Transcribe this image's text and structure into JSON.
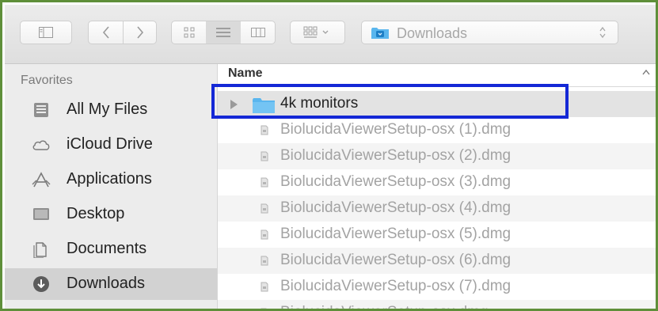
{
  "toolbar": {
    "path_title": "Downloads",
    "icons": [
      "sidebar-toggle-icon",
      "back-icon",
      "forward-icon",
      "icon-view-icon",
      "list-view-icon",
      "column-view-icon",
      "arrange-icon",
      "downloads-folder-icon",
      "stepper-icon"
    ]
  },
  "sidebar": {
    "header": "Favorites",
    "items": [
      {
        "label": "All My Files",
        "icon": "all-files-icon"
      },
      {
        "label": "iCloud Drive",
        "icon": "cloud-icon"
      },
      {
        "label": "Applications",
        "icon": "applications-icon"
      },
      {
        "label": "Desktop",
        "icon": "desktop-icon"
      },
      {
        "label": "Documents",
        "icon": "documents-icon"
      },
      {
        "label": "Downloads",
        "icon": "downloads-icon"
      }
    ],
    "active_item": "Downloads"
  },
  "list": {
    "column_name": "Name",
    "folder": {
      "label": "4k monitors"
    },
    "files": [
      "BiolucidaViewerSetup-osx (1).dmg",
      "BiolucidaViewerSetup-osx (2).dmg",
      "BiolucidaViewerSetup-osx (3).dmg",
      "BiolucidaViewerSetup-osx (4).dmg",
      "BiolucidaViewerSetup-osx (5).dmg",
      "BiolucidaViewerSetup-osx (6).dmg",
      "BiolucidaViewerSetup-osx (7).dmg",
      "BiolucidaViewerSetup-osx.dmg"
    ]
  },
  "colors": {
    "frame": "#5f8f3a",
    "highlight": "#1428d6",
    "folder": "#5ab6ee",
    "sidebar": "#ececec"
  }
}
